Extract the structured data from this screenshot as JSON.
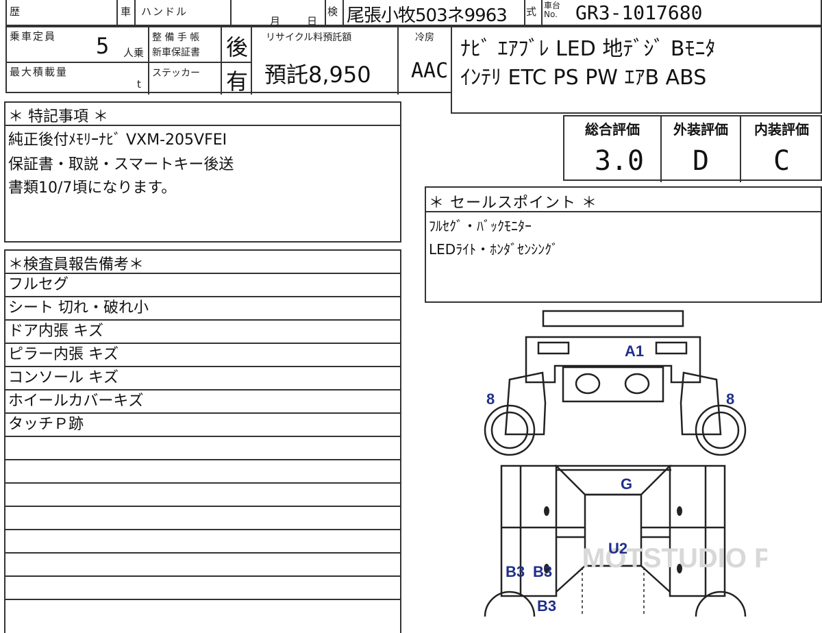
{
  "header": {
    "history_label": "歴",
    "car_label": "車",
    "handle_label": "ハンドル",
    "month_label": "月",
    "day_label": "日",
    "inspection_label": "検",
    "plate": "尾張小牧503ネ9963",
    "type_label": "式",
    "chassis_label": "車台 No.",
    "chassis_no": "GR3-1017680"
  },
  "capacity": {
    "label": "乗車定員",
    "value": "5",
    "unit": "人乗"
  },
  "max_load": {
    "label": "最大積載量",
    "unit": "t"
  },
  "maintenance": {
    "label_line1": "整 備 手 帳",
    "label_line2": "新車保証書",
    "value": "後",
    "sticker_label": "ステッカー",
    "sticker_value": "有"
  },
  "recycle": {
    "label": "リサイクル料預託額",
    "value": "預託8,950"
  },
  "aircon": {
    "label": "冷房",
    "value": "AAC"
  },
  "equipment": {
    "line1": "ﾅﾋﾞ ｴｱﾌﾞﾚ LED 地ﾃﾞｼﾞ Bﾓﾆﾀ",
    "line2": "ｲﾝﾃﾘ ETC PS PW ｴｱB ABS"
  },
  "special_notes": {
    "title": "＊ 特記事項 ＊",
    "lines": [
      "純正後付ﾒﾓﾘｰﾅﾋﾞ VXM-205VFEI",
      "保証書・取説・スマートキー後送",
      "書類10/7頃になります。"
    ]
  },
  "ratings": {
    "overall_label": "総合評価",
    "exterior_label": "外装評価",
    "interior_label": "内装評価",
    "overall": "3.0",
    "exterior": "D",
    "interior": "C"
  },
  "sales_points": {
    "title": "＊ セールスポイント ＊",
    "lines": [
      "ﾌﾙｾｸﾞ・ﾊﾞｯｸﾓﾆﾀｰ",
      "LEDﾗｲﾄ・ﾎﾝﾀﾞｾﾝｼﾝｸﾞ"
    ]
  },
  "inspector": {
    "title": "＊検査員報告備考＊",
    "lines": [
      "フルセグ",
      "シート 切れ・破れ小",
      "ドア内張 キズ",
      "ピラー内張 キズ",
      "コンソール キズ",
      "ホイールカバーキズ",
      "タッチＰ跡",
      "",
      "",
      "",
      "",
      "",
      "",
      "",
      ""
    ]
  },
  "damage_map": {
    "accent": "#1f2f8a",
    "watermark": "MOTSTUDIO PRO",
    "marks": {
      "a1": "A1",
      "front_left": "8",
      "front_right": "8",
      "g": "G",
      "u2": "U2",
      "b3a": "B3",
      "b3b": "B3",
      "b3c": "B3"
    }
  }
}
